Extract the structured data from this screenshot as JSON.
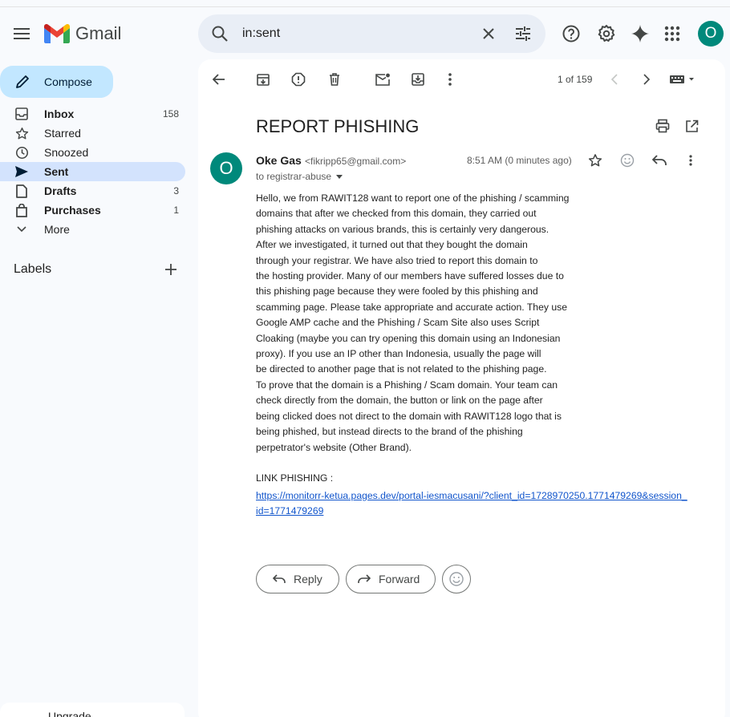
{
  "app": {
    "name": "Gmail",
    "account_initial": "O"
  },
  "search": {
    "query": "in:sent"
  },
  "compose": {
    "label": "Compose"
  },
  "sidebar": {
    "items": [
      {
        "label": "Inbox",
        "count": "158",
        "bold": true,
        "icon": "inbox-icon"
      },
      {
        "label": "Starred",
        "count": "",
        "bold": false,
        "icon": "star-icon"
      },
      {
        "label": "Snoozed",
        "count": "",
        "bold": false,
        "icon": "clock-icon"
      },
      {
        "label": "Sent",
        "count": "",
        "bold": true,
        "icon": "send-icon",
        "active": true
      },
      {
        "label": "Drafts",
        "count": "3",
        "bold": true,
        "icon": "draft-icon"
      },
      {
        "label": "Purchases",
        "count": "1",
        "bold": true,
        "icon": "shopping-bag-icon"
      },
      {
        "label": "More",
        "count": "",
        "bold": false,
        "icon": "chevron-down-icon"
      }
    ],
    "labels_title": "Labels",
    "upgrade_label": "Upgrade"
  },
  "toolbar": {
    "pager": "1 of 159"
  },
  "message": {
    "subject": "REPORT PHISHING",
    "sender_name": "Oke Gas",
    "sender_email": "<fikripp65@gmail.com>",
    "sender_initial": "O",
    "time": "8:51 AM (0 minutes ago)",
    "to": "to registrar-abuse",
    "body": "Hello, we from RAWIT128 want to report one of the phishing / scamming\ndomains that after we checked from this domain, they carried out\nphishing attacks on various brands, this is certainly very dangerous.\nAfter we investigated, it turned out that they bought the domain\nthrough your registrar. We have also tried to report this domain to\nthe hosting provider. Many of our members have suffered losses due to\nthis phishing page because they were fooled by this phishing and\nscamming page. Please take appropriate and accurate action. They use\nGoogle AMP cache and the Phishing / Scam Site also uses Script\nCloaking (maybe you can try opening this domain using an Indonesian\nproxy). If you use an IP other than Indonesia, usually the page will\nbe directed to another page that is not related to the phishing page.\nTo prove that the domain is a Phishing / Scam domain. Your team can\ncheck directly from the domain, the button or link on the page after\nbeing clicked does not direct to the domain with RAWIT128 logo that is\nbeing phished, but instead directs to the brand of the phishing\nperpetrator's website (Other Brand).",
    "link_title": "LINK PHISHING :",
    "link": "https://monitorr-ketua.pages.dev/portal-iesmacusani/?client_id=1728970250.1771479269&session_id=1771479269"
  },
  "actions": {
    "reply": "Reply",
    "forward": "Forward"
  },
  "colors": {
    "accent": "#0b57d0",
    "compose_bg": "#c2e7ff",
    "active_nav": "#d3e3fd",
    "avatar": "#00897b",
    "link": "#1155cc"
  }
}
